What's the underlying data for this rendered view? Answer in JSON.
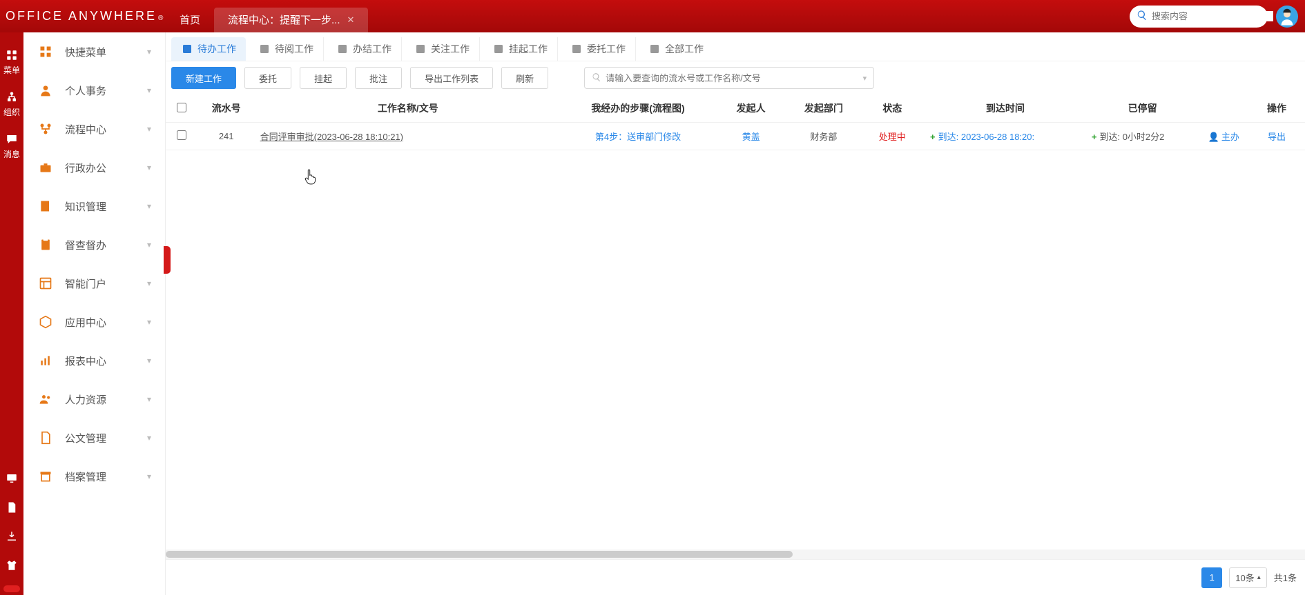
{
  "header": {
    "logo_text": "OFFICE ANYWHERE",
    "logo_sup": "®",
    "tabs": [
      {
        "label": "首页",
        "active": false,
        "closable": false
      },
      {
        "label": "流程中心：提醒下一步...",
        "active": true,
        "closable": true
      }
    ],
    "search_placeholder": "搜索内容"
  },
  "rail": {
    "top": [
      {
        "name": "menu",
        "label": "菜单"
      },
      {
        "name": "org",
        "label": "组织"
      },
      {
        "name": "msg",
        "label": "消息"
      }
    ],
    "bottom_icons": [
      "monitor",
      "file",
      "download",
      "tshirt",
      "redpill"
    ]
  },
  "sidebar": {
    "items": [
      {
        "id": "quick",
        "label": "快捷菜单",
        "color": "#e67817"
      },
      {
        "id": "personal",
        "label": "个人事务",
        "color": "#e67817"
      },
      {
        "id": "process",
        "label": "流程中心",
        "color": "#e67817"
      },
      {
        "id": "admin",
        "label": "行政办公",
        "color": "#e67817"
      },
      {
        "id": "knowledge",
        "label": "知识管理",
        "color": "#e67817"
      },
      {
        "id": "supervise",
        "label": "督查督办",
        "color": "#e67817"
      },
      {
        "id": "portal",
        "label": "智能门户",
        "color": "#e67817"
      },
      {
        "id": "appcenter",
        "label": "应用中心",
        "color": "#e67817"
      },
      {
        "id": "report",
        "label": "报表中心",
        "color": "#e67817"
      },
      {
        "id": "hr",
        "label": "人力资源",
        "color": "#e67817"
      },
      {
        "id": "docs",
        "label": "公文管理",
        "color": "#e67817"
      },
      {
        "id": "archive",
        "label": "档案管理",
        "color": "#e67817"
      }
    ]
  },
  "toolbar": {
    "work_tabs": [
      {
        "id": "pending",
        "label": "待办工作",
        "active": true
      },
      {
        "id": "toread",
        "label": "待阅工作"
      },
      {
        "id": "done",
        "label": "办结工作"
      },
      {
        "id": "follow",
        "label": "关注工作"
      },
      {
        "id": "hold",
        "label": "挂起工作"
      },
      {
        "id": "delegate",
        "label": "委托工作"
      },
      {
        "id": "all",
        "label": "全部工作"
      }
    ],
    "buttons": {
      "new_work": "新建工作",
      "delegate": "委托",
      "hold": "挂起",
      "annotate": "批注",
      "export_list": "导出工作列表",
      "refresh": "刷新"
    },
    "filter_placeholder": "请输入要查询的流水号或工作名称/文号"
  },
  "table": {
    "columns": [
      "",
      "流水号",
      "工作名称/文号",
      "我经办的步骤(流程图)",
      "发起人",
      "发起部门",
      "状态",
      "到达时间",
      "已停留",
      "",
      "操作"
    ],
    "rows": [
      {
        "flow_no": "241",
        "work_name": "合同评审审批(2023-06-28 18:10:21)",
        "step_text": "第4步：送审部门修改",
        "initiator": "黄盖",
        "department": "财务部",
        "status": "处理中",
        "arrive_prefix": "到达:",
        "arrive_time": "2023-06-28 18:20:",
        "stay_prefix": "到达:",
        "stay_text": "0小时2分2",
        "role": "主办",
        "op": "导出"
      }
    ]
  },
  "footer": {
    "page_current": "1",
    "page_size": "10条",
    "total_prefix": "共",
    "total_suffix": "1条"
  }
}
